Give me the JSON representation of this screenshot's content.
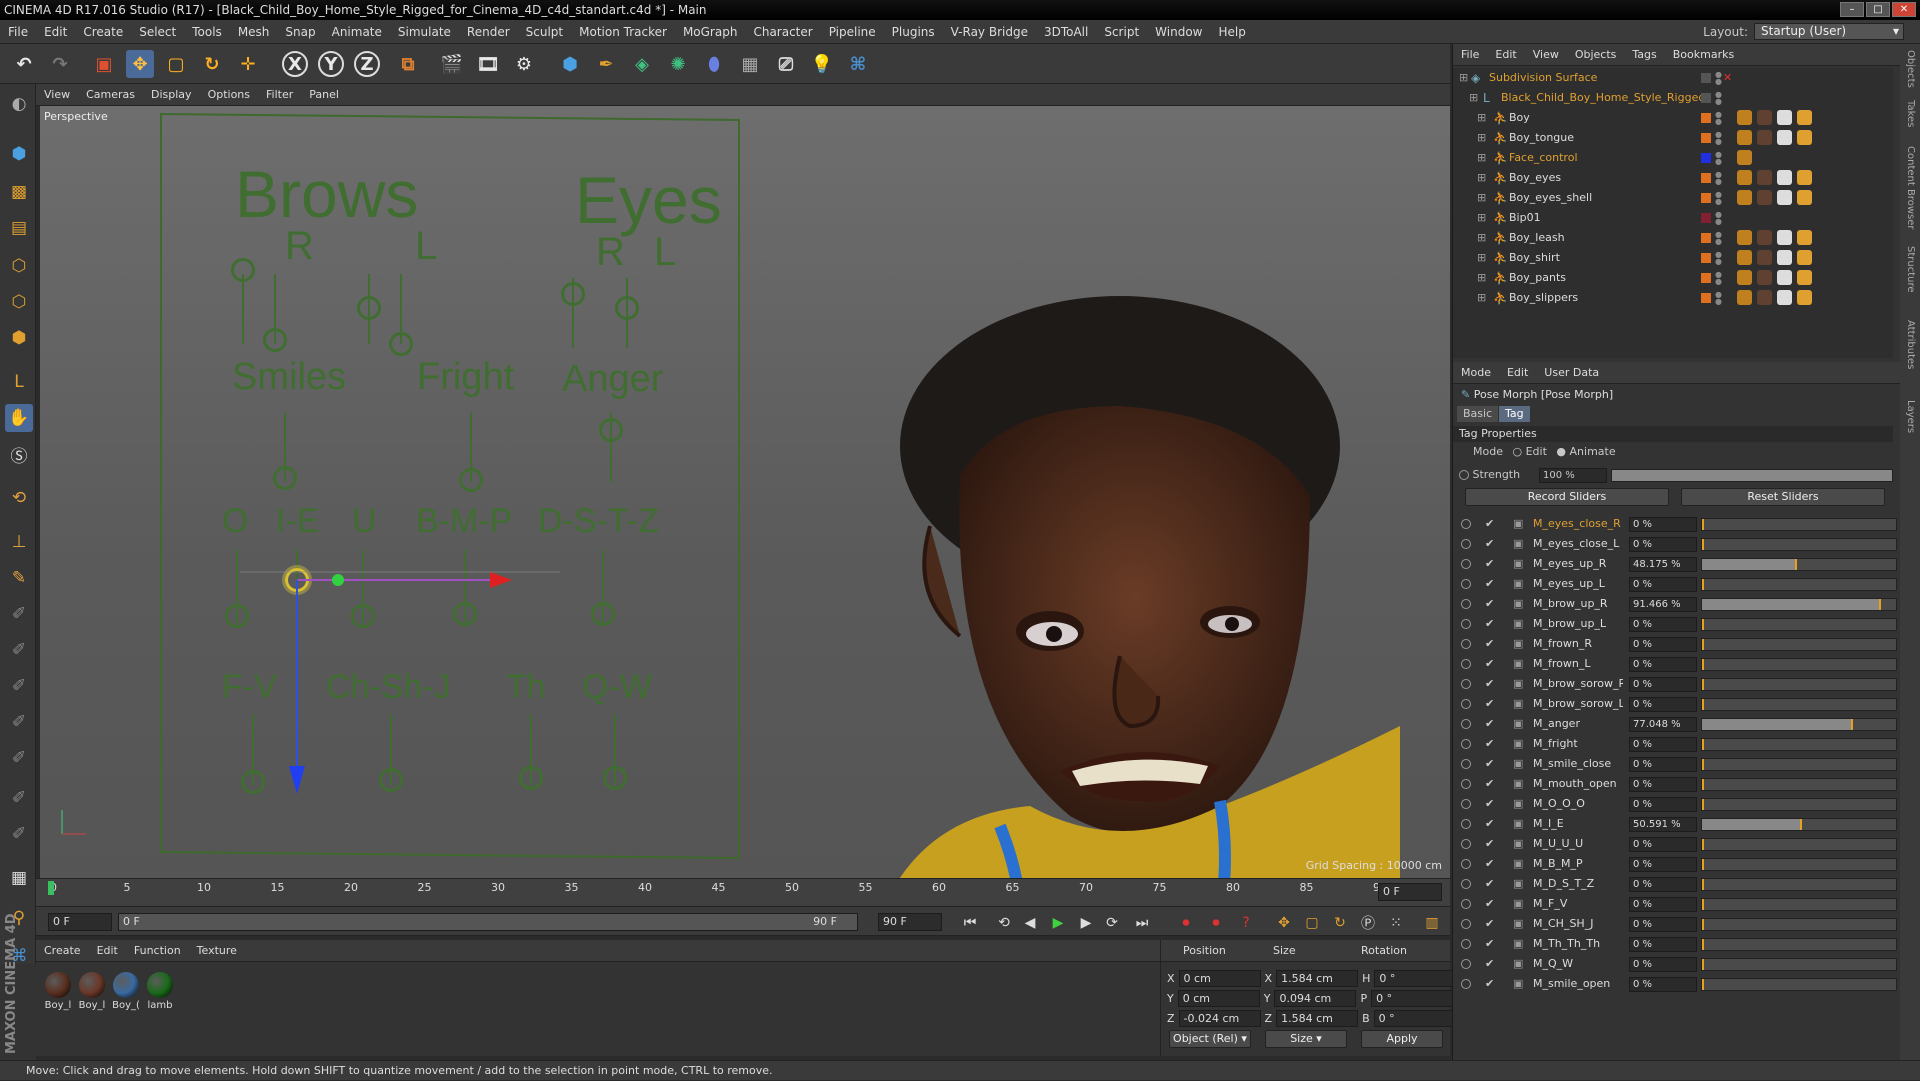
{
  "window": {
    "title": "CINEMA 4D R17.016 Studio (R17) - [Black_Child_Boy_Home_Style_Rigged_for_Cinema_4D_c4d_standart.c4d *] - Main"
  },
  "menubar": [
    "File",
    "Edit",
    "Create",
    "Select",
    "Tools",
    "Mesh",
    "Snap",
    "Animate",
    "Simulate",
    "Render",
    "Sculpt",
    "Motion Tracker",
    "MoGraph",
    "Character",
    "Pipeline",
    "Plugins",
    "V-Ray Bridge",
    "3DToAll",
    "Script",
    "Window",
    "Help"
  ],
  "layout": {
    "label": "Layout:",
    "value": "Startup (User)"
  },
  "toolbar": {
    "x": "X",
    "y": "Y",
    "z": "Z"
  },
  "viewport": {
    "menu": [
      "View",
      "Cameras",
      "Display",
      "Options",
      "Filter",
      "Panel"
    ],
    "label": "Perspective",
    "grid_spacing": "Grid Spacing : 10000 cm",
    "panel": {
      "brows": "Brows",
      "eyes": "Eyes",
      "r": "R",
      "l": "L",
      "smiles": "Smiles",
      "fright": "Fright",
      "anger": "Anger",
      "o": "O",
      "ie": "I-E",
      "u": "U",
      "bmp": "B-M-P",
      "dstz": "D-S-T-Z",
      "fv": "F-V",
      "chshj": "Ch-Sh-J",
      "th": "Th",
      "qw": "Q-W"
    }
  },
  "timeline": {
    "ticks": [
      "0",
      "5",
      "10",
      "15",
      "20",
      "25",
      "30",
      "35",
      "40",
      "45",
      "50",
      "55",
      "60",
      "65",
      "70",
      "75",
      "80",
      "85",
      "90"
    ],
    "current": "0 F"
  },
  "playbar": {
    "start": "0 F",
    "range_start": "0 F",
    "range_end": "90 F",
    "end": "90 F"
  },
  "materials": {
    "menu": [
      "Create",
      "Edit",
      "Function",
      "Texture"
    ],
    "items": [
      {
        "label": "Boy_l",
        "color": "#5a3020"
      },
      {
        "label": "Boy_l",
        "color": "#6a3828"
      },
      {
        "label": "Boy_(",
        "color": "#3a6aa0"
      },
      {
        "label": "lamb",
        "color": "#1a6a1a"
      }
    ]
  },
  "coords": {
    "headers": [
      "Position",
      "Size",
      "Rotation"
    ],
    "rows": [
      {
        "axis": "X",
        "pos": "0 cm",
        "saxis": "X",
        "size": "1.584 cm",
        "raxis": "H",
        "rot": "0 °"
      },
      {
        "axis": "Y",
        "pos": "0 cm",
        "saxis": "Y",
        "size": "0.094 cm",
        "raxis": "P",
        "rot": "0 °"
      },
      {
        "axis": "Z",
        "pos": "-0.024 cm",
        "saxis": "Z",
        "size": "1.584 cm",
        "raxis": "B",
        "rot": "0 °"
      }
    ],
    "mode": "Object (Rel)",
    "size_mode": "Size",
    "apply": "Apply"
  },
  "status": "Move: Click and drag to move elements. Hold down SHIFT to quantize movement / add to the selection in point mode, CTRL to remove.",
  "maxon": "MAXON CINEMA 4D",
  "objects": {
    "menu": [
      "File",
      "Edit",
      "View",
      "Objects",
      "Tags",
      "Bookmarks"
    ],
    "rows": [
      {
        "name": "Subdivision Surface",
        "color": "#e0a030",
        "swatch": "#555"
      },
      {
        "name": "Black_Child_Boy_Home_Style_Rigged",
        "color": "#e0a030",
        "swatch": "#555"
      },
      {
        "name": "Boy",
        "color": "#dddddd",
        "swatch": "#e07020"
      },
      {
        "name": "Boy_tongue",
        "color": "#dddddd",
        "swatch": "#e07020"
      },
      {
        "name": "Face_control",
        "color": "#e0a030",
        "swatch": "#2030e0"
      },
      {
        "name": "Boy_eyes",
        "color": "#dddddd",
        "swatch": "#e07020"
      },
      {
        "name": "Boy_eyes_shell",
        "color": "#dddddd",
        "swatch": "#e07020"
      },
      {
        "name": "Bip01",
        "color": "#dddddd",
        "swatch": "#802030"
      },
      {
        "name": "Boy_leash",
        "color": "#dddddd",
        "swatch": "#e07020"
      },
      {
        "name": "Boy_shirt",
        "color": "#dddddd",
        "swatch": "#e07020"
      },
      {
        "name": "Boy_pants",
        "color": "#dddddd",
        "swatch": "#e07020"
      },
      {
        "name": "Boy_slippers",
        "color": "#dddddd",
        "swatch": "#e07020"
      }
    ]
  },
  "attributes": {
    "menu": [
      "Mode",
      "Edit",
      "User Data"
    ],
    "title": "Pose Morph [Pose Morph]",
    "tabs": [
      "Basic",
      "Tag"
    ],
    "section": "Tag Properties",
    "mode_label": "Mode",
    "mode_edit": "Edit",
    "mode_animate": "Animate",
    "strength_label": "Strength",
    "strength_value": "100 %",
    "strength": 1.0,
    "record": "Record Sliders",
    "reset": "Reset Sliders",
    "morphs": [
      {
        "name": "M_eyes_close_R",
        "value": "0 %",
        "frac": 0,
        "orange": true
      },
      {
        "name": "M_eyes_close_L",
        "value": "0 %",
        "frac": 0
      },
      {
        "name": "M_eyes_up_R",
        "value": "48.175 %",
        "frac": 0.48175
      },
      {
        "name": "M_eyes_up_L",
        "value": "0 %",
        "frac": 0
      },
      {
        "name": "M_brow_up_R",
        "value": "91.466 %",
        "frac": 0.91466
      },
      {
        "name": "M_brow_up_L",
        "value": "0 %",
        "frac": 0
      },
      {
        "name": "M_frown_R",
        "value": "0 %",
        "frac": 0
      },
      {
        "name": "M_frown_L",
        "value": "0 %",
        "frac": 0
      },
      {
        "name": "M_brow_sorow_R",
        "value": "0 %",
        "frac": 0
      },
      {
        "name": "M_brow_sorow_L",
        "value": "0 %",
        "frac": 0
      },
      {
        "name": "M_anger",
        "value": "77.048 %",
        "frac": 0.77048
      },
      {
        "name": "M_fright",
        "value": "0 %",
        "frac": 0
      },
      {
        "name": "M_smile_close",
        "value": "0 %",
        "frac": 0
      },
      {
        "name": "M_mouth_open",
        "value": "0 %",
        "frac": 0
      },
      {
        "name": "M_O_O_O",
        "value": "0 %",
        "frac": 0
      },
      {
        "name": "M_I_E",
        "value": "50.591 %",
        "frac": 0.50591
      },
      {
        "name": "M_U_U_U",
        "value": "0 %",
        "frac": 0
      },
      {
        "name": "M_B_M_P",
        "value": "0 %",
        "frac": 0
      },
      {
        "name": "M_D_S_T_Z",
        "value": "0 %",
        "frac": 0
      },
      {
        "name": "M_F_V",
        "value": "0 %",
        "frac": 0
      },
      {
        "name": "M_CH_SH_J",
        "value": "0 %",
        "frac": 0
      },
      {
        "name": "M_Th_Th_Th",
        "value": "0 %",
        "frac": 0
      },
      {
        "name": "M_Q_W",
        "value": "0 %",
        "frac": 0
      },
      {
        "name": "M_smile_open",
        "value": "0 %",
        "frac": 0
      }
    ]
  },
  "side_tabs": [
    "Objects",
    "Takes",
    "Content Browser",
    "Structure",
    "Attributes",
    "Layers"
  ]
}
